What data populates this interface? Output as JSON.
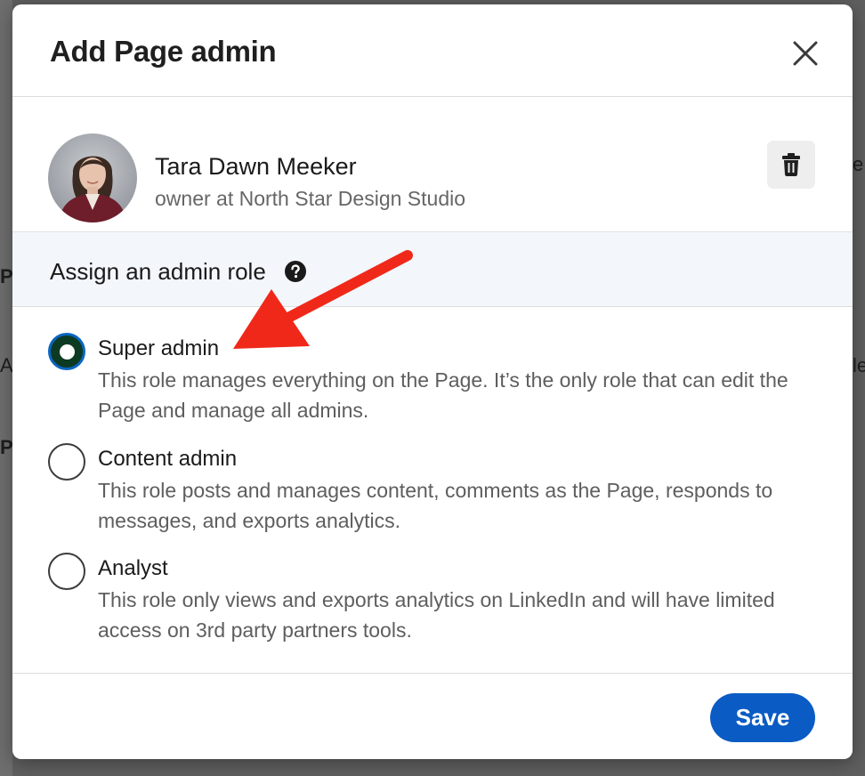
{
  "modal": {
    "title": "Add Page admin",
    "close_icon": "close-icon"
  },
  "person": {
    "name": "Tara Dawn Meeker",
    "subtitle": "owner at North Star Design Studio"
  },
  "role_section": {
    "heading": "Assign an admin role",
    "help_icon": "question-circle-icon"
  },
  "roles": [
    {
      "label": "Super admin",
      "description": "This role manages everything on the Page. It’s the only role that can edit the Page and manage all admins.",
      "selected": true
    },
    {
      "label": "Content admin",
      "description": "This role posts and manages content, comments as the Page, responds to messages, and exports analytics.",
      "selected": false
    },
    {
      "label": "Analyst",
      "description": "This role only views and exports analytics on LinkedIn and will have limited access on 3rd party partners tools.",
      "selected": false
    }
  ],
  "footer": {
    "save_label": "Save"
  },
  "colors": {
    "accent": "#0a66c2",
    "save_button": "#0a5bc4",
    "radio_fill": "#0c3a23",
    "annotation_arrow": "#f0281a",
    "role_header_bg": "#f3f6fa"
  },
  "background_page": {
    "left_fragments": [
      "P",
      "Al",
      "Pr"
    ],
    "right_fragments": [
      "e",
      "le"
    ]
  }
}
